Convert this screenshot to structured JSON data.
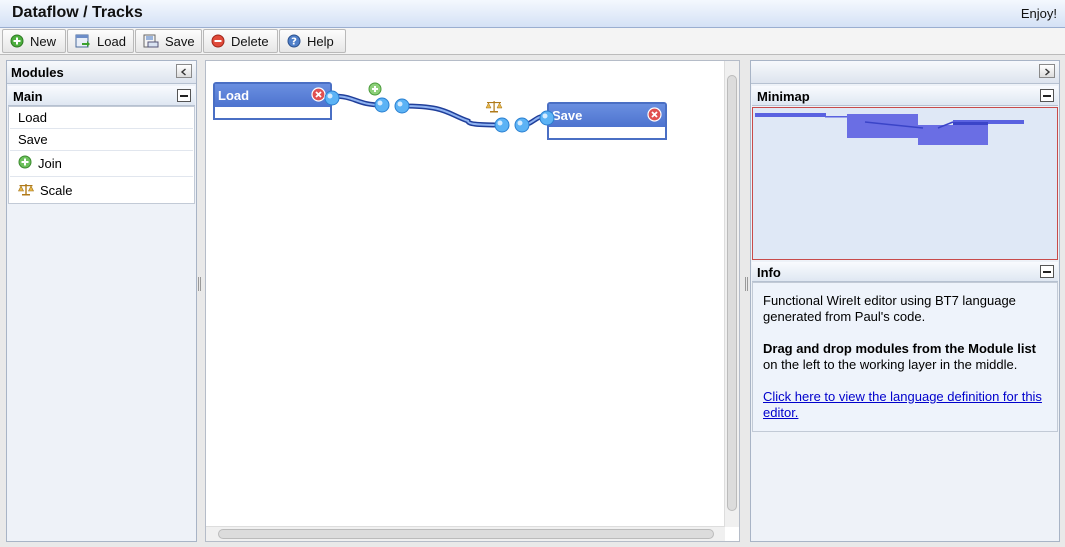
{
  "header": {
    "title": "Dataflow / Tracks",
    "greeting": "Enjoy!"
  },
  "toolbar": {
    "buttons": [
      {
        "label": "New",
        "icon": "plus-circle-icon"
      },
      {
        "label": "Load",
        "icon": "load-icon"
      },
      {
        "label": "Save",
        "icon": "save-icon"
      },
      {
        "label": "Delete",
        "icon": "delete-circle-icon"
      },
      {
        "label": "Help",
        "icon": "help-icon"
      }
    ]
  },
  "modules_panel": {
    "title": "Modules",
    "group_title": "Main",
    "items": [
      {
        "label": "Load",
        "icon": ""
      },
      {
        "label": "Save",
        "icon": ""
      },
      {
        "label": "Join",
        "icon": "plus-circle-icon"
      },
      {
        "label": "Scale",
        "icon": "scale-icon"
      }
    ]
  },
  "canvas": {
    "nodes": [
      {
        "title": "Load"
      },
      {
        "title": "Save"
      }
    ]
  },
  "minimap": {
    "title": "Minimap"
  },
  "info": {
    "title": "Info",
    "paragraph1": "Functional WireIt editor using BT7 language generated from Paul's code.",
    "paragraph2_bold": "Drag and drop modules from the Module list",
    "paragraph2_rest": " on the left to the working layer in the middle.",
    "link_text": "Click here to view the language definition for this editor."
  },
  "colors": {
    "node_header": "#5a7fd8",
    "wire": "#2a55c9",
    "link": "#0000cc"
  }
}
